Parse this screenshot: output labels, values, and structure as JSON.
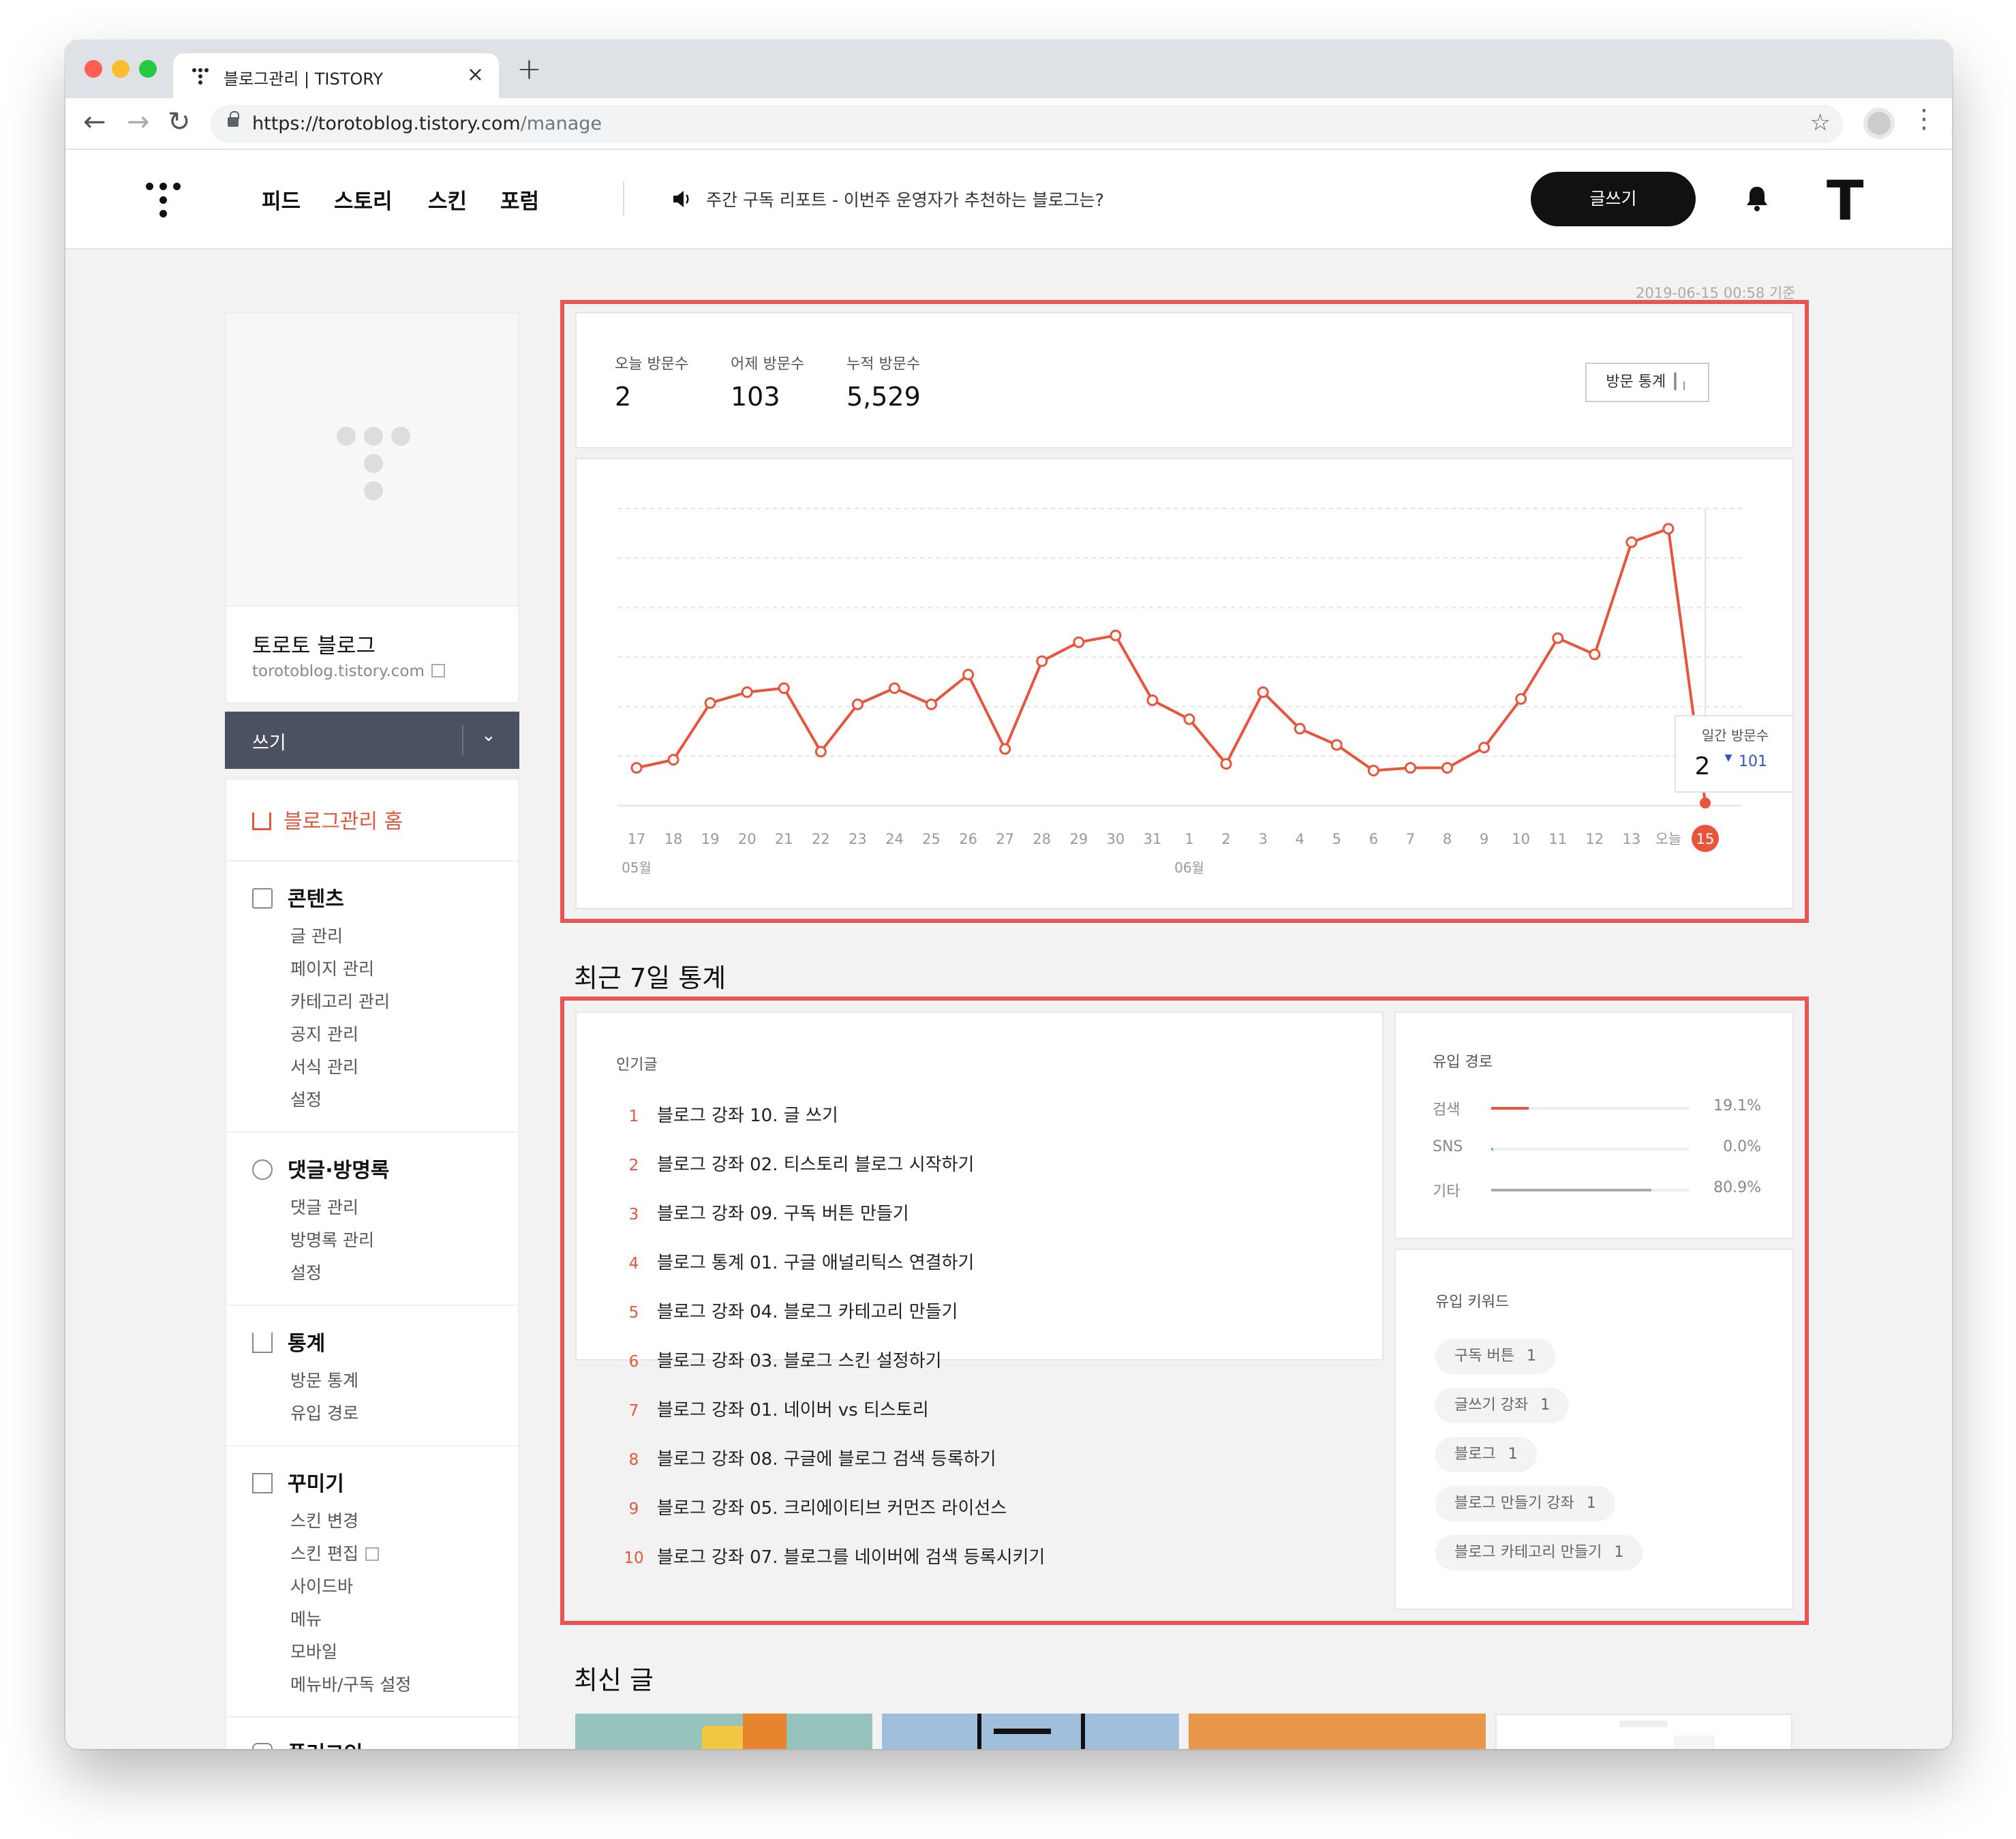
{
  "browser": {
    "tab_title": "블로그관리 | TISTORY",
    "url_main": "https://torotoblog.tistory.com",
    "url_path": "/manage",
    "new_tab": "+",
    "close": "×",
    "back": "←",
    "forward": "→",
    "reload": "↻",
    "bookmark": "☆",
    "menu": "⋮"
  },
  "header": {
    "nav": [
      "피드",
      "스토리",
      "스킨",
      "포럼"
    ],
    "notice": "주간 구독 리포트 - 이번주 운영자가 추천하는 블로그는?",
    "write_button": "글쓰기",
    "profile_letter": "T"
  },
  "sidebar": {
    "blog_name": "토로토 블로그",
    "blog_url": "torotoblog.tistory.com",
    "write_label": "쓰기",
    "home": "블로그관리 홈",
    "sections": [
      {
        "title": "콘텐츠",
        "items": [
          "글 관리",
          "페이지 관리",
          "카테고리 관리",
          "공지 관리",
          "서식 관리",
          "설정"
        ]
      },
      {
        "title": "댓글·방명록",
        "items": [
          "댓글 관리",
          "방명록 관리",
          "설정"
        ]
      },
      {
        "title": "통계",
        "items": [
          "방문 통계",
          "유입 경로"
        ]
      },
      {
        "title": "꾸미기",
        "items": [
          "스킨 변경",
          "스킨 편집",
          "사이드바",
          "메뉴",
          "모바일",
          "메뉴바/구독 설정"
        ]
      },
      {
        "title": "플러그인",
        "items": []
      }
    ]
  },
  "stats": {
    "timestamp": "2019-06-15 00:58 기준",
    "today_label": "오늘 방문수",
    "today_value": "2",
    "yesterday_label": "어제 방문수",
    "yesterday_value": "103",
    "total_label": "누적 방문수",
    "total_value": "5,529",
    "button": "방문 통계"
  },
  "chart_data": {
    "type": "line",
    "x": [
      "17",
      "18",
      "19",
      "20",
      "21",
      "22",
      "23",
      "24",
      "25",
      "26",
      "27",
      "28",
      "29",
      "30",
      "31",
      "1",
      "2",
      "3",
      "4",
      "5",
      "6",
      "7",
      "8",
      "9",
      "10",
      "11",
      "12",
      "13",
      "오늘",
      "15"
    ],
    "month_labels": [
      {
        "at": "17",
        "label": "05월"
      },
      {
        "at": "1",
        "label": "06월"
      }
    ],
    "series": [
      {
        "values": [
          28,
          34,
          76,
          84,
          87,
          40,
          75,
          87,
          75,
          97,
          42,
          107,
          121,
          126,
          78,
          64,
          31,
          84,
          57,
          45,
          26,
          28,
          28,
          43,
          79,
          124,
          112,
          195,
          205,
          2
        ]
      }
    ],
    "ylim": [
      0,
      220
    ],
    "grid": true,
    "line_color": "#e8553c",
    "tooltip": {
      "label": "일간 방문수",
      "value": "2",
      "diff": "101",
      "diff_direction": "down"
    }
  },
  "recent7": {
    "heading": "최근 7일 통계",
    "popular_title": "인기글",
    "popular": [
      {
        "rank": "1",
        "title": "블로그 강좌 10. 글 쓰기"
      },
      {
        "rank": "2",
        "title": "블로그 강좌 02. 티스토리 블로그 시작하기"
      },
      {
        "rank": "3",
        "title": "블로그 강좌 09. 구독 버튼 만들기"
      },
      {
        "rank": "4",
        "title": "블로그 통계 01. 구글 애널리틱스 연결하기"
      },
      {
        "rank": "5",
        "title": "블로그 강좌 04. 블로그 카테고리 만들기"
      },
      {
        "rank": "6",
        "title": "블로그 강좌 03. 블로그 스킨 설정하기"
      },
      {
        "rank": "7",
        "title": "블로그 강좌 01. 네이버 vs 티스토리"
      },
      {
        "rank": "8",
        "title": "블로그 강좌 08. 구글에 블로그 검색 등록하기"
      },
      {
        "rank": "9",
        "title": "블로그 강좌 05. 크리에이티브 커먼즈 라이선스"
      },
      {
        "rank": "10",
        "title": "블로그 강좌 07. 블로그를 네이버에 검색 등록시키기"
      }
    ],
    "referrer_title": "유입 경로",
    "referrers": [
      {
        "label": "검색",
        "value": "19.1%",
        "fraction": 0.191,
        "color": "#e8553c"
      },
      {
        "label": "SNS",
        "value": "0.0%",
        "fraction": 0.0,
        "color": "#5cc6c6"
      },
      {
        "label": "기타",
        "value": "80.9%",
        "fraction": 0.809,
        "color": "#aaaaaa"
      }
    ],
    "keywords_title": "유입 키워드",
    "keywords": [
      {
        "text": "구독 버튼",
        "count": "1"
      },
      {
        "text": "글쓰기 강좌",
        "count": "1"
      },
      {
        "text": "블로그",
        "count": "1"
      },
      {
        "text": "블로그 만들기 강좌",
        "count": "1"
      },
      {
        "text": "블로그 카테고리 만들기",
        "count": "1"
      }
    ]
  },
  "latest": {
    "heading": "최신 글"
  }
}
